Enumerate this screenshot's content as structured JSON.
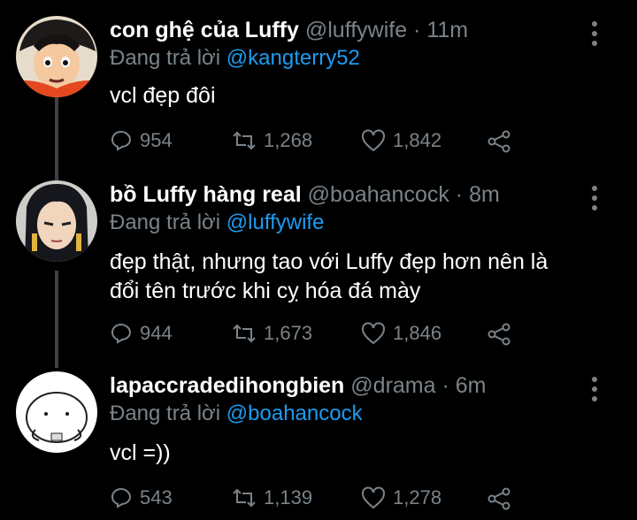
{
  "tweets": [
    {
      "name": "con ghệ của Luffy",
      "handle": "@luffywife",
      "sep": " · ",
      "time": "11m",
      "replying_prefix": "Đang trả lời ",
      "replying_to": "@kangterry52",
      "text_lines": [
        "vcl đẹp đôi"
      ],
      "replies": "954",
      "retweets": "1,268",
      "likes": "1,842"
    },
    {
      "name": "bồ Luffy hàng real",
      "handle": "@boahancock",
      "sep": " · ",
      "time": "8m",
      "replying_prefix": "Đang trả lời ",
      "replying_to": "@luffywife",
      "text_lines": [
        "đẹp thật, nhưng tao với Luffy đẹp hơn nên là",
        "đổi tên trước khi cỵ hóa đá mày"
      ],
      "replies": "944",
      "retweets": "1,673",
      "likes": "1,846"
    },
    {
      "name": "lapaccradedihongbien",
      "handle": "@drama",
      "sep": " · ",
      "time": "6m",
      "replying_prefix": "Đang trả lời ",
      "replying_to": "@boahancock",
      "text_lines": [
        "vcl =))"
      ],
      "replies": "543",
      "retweets": "1,139",
      "likes": "1,278"
    }
  ],
  "icons": {
    "reply": "reply-icon",
    "retweet": "retweet-icon",
    "like": "heart-icon",
    "share": "share-icon",
    "menu": "more-vertical-icon"
  },
  "colors": {
    "background": "#000000",
    "muted": "#7a8389",
    "mention": "#1d9bf0",
    "thread": "#3d4349"
  }
}
